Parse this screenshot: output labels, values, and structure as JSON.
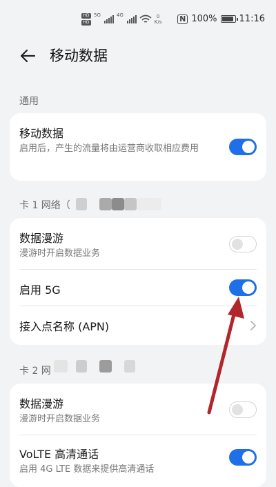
{
  "status_bar": {
    "hd_top": "HD",
    "hd_bottom": "HD",
    "net_tag_1": "5G",
    "net_tag_2": "4G",
    "speed_value": "0",
    "speed_unit": "K/s",
    "battery_text": "100%",
    "battery_level": 1.0,
    "time": "11:16"
  },
  "header": {
    "title": "移动数据",
    "back_icon": "back-arrow-icon"
  },
  "section_general": {
    "label": "通用",
    "mobile_data": {
      "title": "移动数据",
      "subtitle": "启用后，产生的流量将由运营商收取相应费用",
      "enabled": true
    }
  },
  "section_card1": {
    "label": "卡 1 网络（",
    "data_roaming": {
      "title": "数据漫游",
      "subtitle": "漫游时开启数据业务",
      "enabled": false
    },
    "enable_5g": {
      "title": "启用 5G",
      "enabled": true
    },
    "apn": {
      "title": "接入点名称 (APN)"
    }
  },
  "section_card2": {
    "label": "卡 2 网",
    "data_roaming": {
      "title": "数据漫游",
      "subtitle": "漫游时开启数据业务",
      "enabled": false
    },
    "volte": {
      "title": "VoLTE 高清通话",
      "subtitle": "启用 4G LTE 数据来提供高清通话",
      "enabled": true
    }
  },
  "colors": {
    "toggle_on": "#1f6fe8",
    "annotation_arrow": "#b0262b",
    "background": "#f1f3f5"
  }
}
